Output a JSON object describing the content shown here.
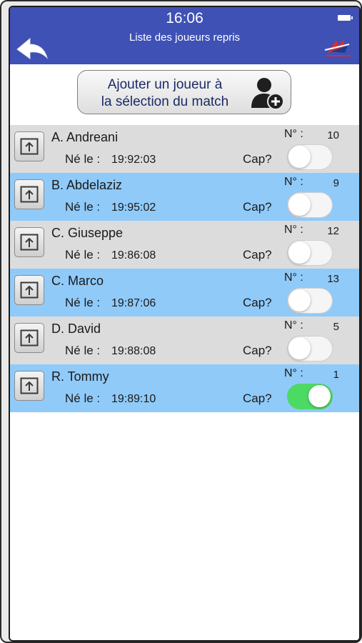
{
  "status_bar": {
    "time": "16:06",
    "battery_icon": "battery-icon"
  },
  "header": {
    "title": "Liste des joueurs repris",
    "back_icon": "back-arrow-icon",
    "logo_icon": "club-logo",
    "color": "#3f51b5"
  },
  "add_button": {
    "line1": "Ajouter un joueur à",
    "line2": "la sélection du match",
    "icon": "add-user-icon"
  },
  "labels": {
    "born": "Né le :",
    "number": "N° :",
    "captain": "Cap?"
  },
  "players": [
    {
      "name": "A. Andreani",
      "born": "19:92:03",
      "number": "10",
      "captain": false
    },
    {
      "name": "B. Abdelaziz",
      "born": "19:95:02",
      "number": "9",
      "captain": false
    },
    {
      "name": "C. Giuseppe",
      "born": "19:86:08",
      "number": "12",
      "captain": false
    },
    {
      "name": "C. Marco",
      "born": "19:87:06",
      "number": "13",
      "captain": false
    },
    {
      "name": "D. David",
      "born": "19:88:08",
      "number": "5",
      "captain": false
    },
    {
      "name": "R. Tommy",
      "born": "19:89:10",
      "number": "1",
      "captain": true
    }
  ],
  "colors": {
    "row_light": "#dcdcdc",
    "row_blue": "#90caf9",
    "toggle_on": "#4cd964"
  }
}
